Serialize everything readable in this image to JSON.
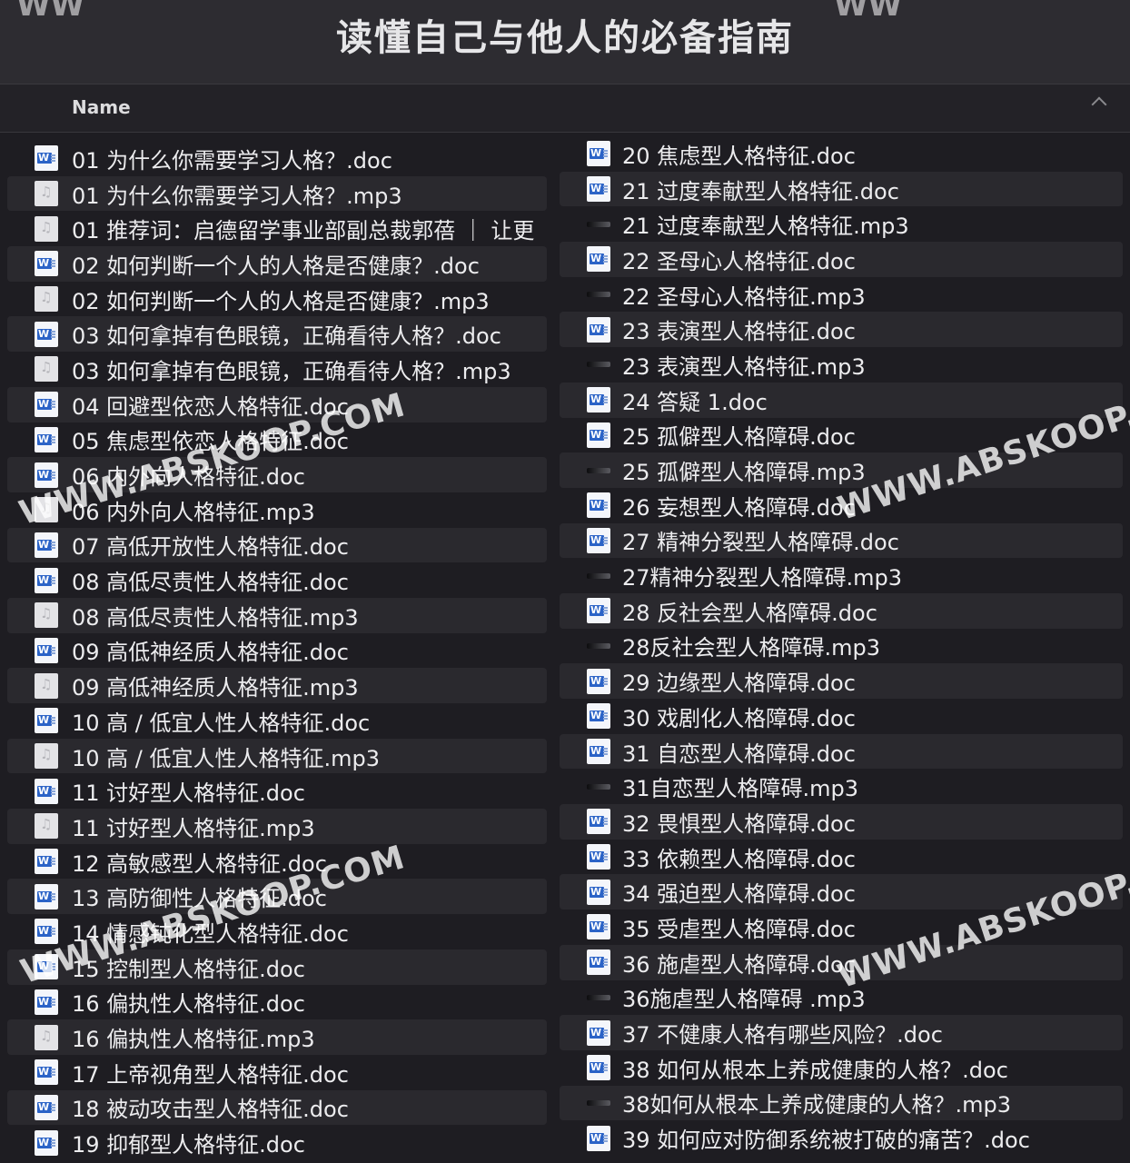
{
  "window": {
    "title": "读懂自己与他人的必备指南"
  },
  "header": {
    "name_col": "Name"
  },
  "files_left": [
    {
      "name": "01 为什么你需要学习人格？.doc",
      "type": "doc"
    },
    {
      "name": "01 为什么你需要学习人格？.mp3",
      "type": "mp3"
    },
    {
      "name": "01 推荐词：启德留学事业部副总裁郭蓓 ｜ 让更",
      "type": "mp3"
    },
    {
      "name": "02 如何判断一个人的人格是否健康？.doc",
      "type": "doc"
    },
    {
      "name": "02 如何判断一个人的人格是否健康？.mp3",
      "type": "mp3"
    },
    {
      "name": "03 如何拿掉有色眼镜，正确看待人格？.doc",
      "type": "doc"
    },
    {
      "name": "03 如何拿掉有色眼镜，正确看待人格？.mp3",
      "type": "mp3"
    },
    {
      "name": "04 回避型依恋人格特征.doc",
      "type": "doc"
    },
    {
      "name": "05 焦虑型依恋人格特征.doc",
      "type": "doc"
    },
    {
      "name": "06 内外向人格特征.doc",
      "type": "doc"
    },
    {
      "name": "06 内外向人格特征.mp3",
      "type": "mp3"
    },
    {
      "name": "07 高低开放性人格特征.doc",
      "type": "doc"
    },
    {
      "name": "08 高低尽责性人格特征.doc",
      "type": "doc"
    },
    {
      "name": "08 高低尽责性人格特征.mp3",
      "type": "mp3"
    },
    {
      "name": "09 高低神经质人格特征.doc",
      "type": "doc"
    },
    {
      "name": "09 高低神经质人格特征.mp3",
      "type": "mp3"
    },
    {
      "name": "10 高 / 低宜人性人格特征.doc",
      "type": "doc"
    },
    {
      "name": "10 高 / 低宜人性人格特征.mp3",
      "type": "mp3"
    },
    {
      "name": "11 讨好型人格特征.doc",
      "type": "doc"
    },
    {
      "name": "11 讨好型人格特征.mp3",
      "type": "mp3"
    },
    {
      "name": "12 高敏感型人格特征.doc",
      "type": "doc"
    },
    {
      "name": "13 高防御性人格特征.doc",
      "type": "doc"
    },
    {
      "name": "14 情感钝化型人格特征.doc",
      "type": "doc"
    },
    {
      "name": "15 控制型人格特征.doc",
      "type": "doc"
    },
    {
      "name": "16 偏执性人格特征.doc",
      "type": "doc"
    },
    {
      "name": "16 偏执性人格特征.mp3",
      "type": "mp3"
    },
    {
      "name": "17 上帝视角型人格特征.doc",
      "type": "doc"
    },
    {
      "name": "18 被动攻击型人格特征.doc",
      "type": "doc"
    },
    {
      "name": "19 抑郁型人格特征.doc",
      "type": "doc"
    }
  ],
  "files_right": [
    {
      "name": "20 焦虑型人格特征.doc",
      "type": "doc"
    },
    {
      "name": "21 过度奉献型人格特征.doc",
      "type": "doc"
    },
    {
      "name": "21 过度奉献型人格特征.mp3",
      "type": "audio"
    },
    {
      "name": "22 圣母心人格特征.doc",
      "type": "doc"
    },
    {
      "name": "22 圣母心人格特征.mp3",
      "type": "audio"
    },
    {
      "name": "23 表演型人格特征.doc",
      "type": "doc"
    },
    {
      "name": "23 表演型人格特征.mp3",
      "type": "audio"
    },
    {
      "name": "24 答疑 1.doc",
      "type": "doc"
    },
    {
      "name": "25 孤僻型人格障碍.doc",
      "type": "doc"
    },
    {
      "name": "25 孤僻型人格障碍.mp3",
      "type": "audio"
    },
    {
      "name": "26 妄想型人格障碍.doc",
      "type": "doc"
    },
    {
      "name": "27 精神分裂型人格障碍.doc",
      "type": "doc"
    },
    {
      "name": "27精神分裂型人格障碍.mp3",
      "type": "audio"
    },
    {
      "name": "28 反社会型人格障碍.doc",
      "type": "doc"
    },
    {
      "name": "28反社会型人格障碍.mp3",
      "type": "audio"
    },
    {
      "name": "29 边缘型人格障碍.doc",
      "type": "doc"
    },
    {
      "name": "30 戏剧化人格障碍.doc",
      "type": "doc"
    },
    {
      "name": "31 自恋型人格障碍.doc",
      "type": "doc"
    },
    {
      "name": "31自恋型人格障碍.mp3",
      "type": "audio"
    },
    {
      "name": "32 畏惧型人格障碍.doc",
      "type": "doc"
    },
    {
      "name": "33 依赖型人格障碍.doc",
      "type": "doc"
    },
    {
      "name": "34 强迫型人格障碍.doc",
      "type": "doc"
    },
    {
      "name": "35 受虐型人格障碍.doc",
      "type": "doc"
    },
    {
      "name": "36 施虐型人格障碍.doc",
      "type": "doc"
    },
    {
      "name": "36施虐型人格障碍 .mp3",
      "type": "audio"
    },
    {
      "name": "37 不健康人格有哪些风险？.doc",
      "type": "doc"
    },
    {
      "name": "38 如何从根本上养成健康的人格？.doc",
      "type": "doc"
    },
    {
      "name": "38如何从根本上养成健康的人格？.mp3",
      "type": "audio"
    },
    {
      "name": "39 如何应对防御系统被打破的痛苦？.doc",
      "type": "doc"
    }
  ],
  "watermark": {
    "text1": "WWW.ABSKOOP.COM",
    "text2": "WWW.ABSKOOP.COM",
    "text3": "WWW.ABSKOOP.C",
    "text4": "WWW.ABSKOOP.C",
    "corner_left": "WW",
    "corner_right": "WW"
  }
}
